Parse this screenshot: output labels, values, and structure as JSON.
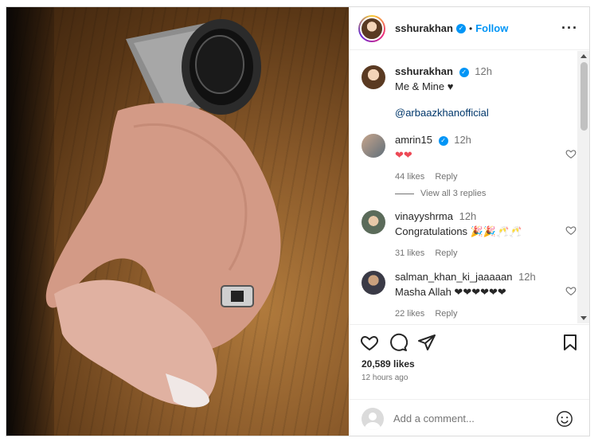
{
  "header": {
    "username": "sshurakhan",
    "follow_label": "Follow",
    "more_icon": "more-horizontal-icon"
  },
  "caption": {
    "username": "sshurakhan",
    "time": "12h",
    "text": "Me & Mine ♥",
    "tag": "@arbaazkhanofficial"
  },
  "comments": [
    {
      "username": "amrin15",
      "verified": true,
      "time": "12h",
      "text": "❤❤",
      "likes": "44 likes",
      "reply_label": "Reply"
    },
    {
      "username": "vinayyshrma",
      "verified": false,
      "time": "12h",
      "text": "Congratulations 🎉🎉🥂🥂",
      "likes": "31 likes",
      "reply_label": "Reply"
    },
    {
      "username": "salman_khan_ki_jaaaaan",
      "verified": false,
      "time": "12h",
      "text": "Masha Allah ❤❤❤❤❤❤",
      "likes": "22 likes",
      "reply_label": "Reply"
    }
  ],
  "view_replies_label": "View all 3 replies",
  "actions": {
    "like_count": "20,589 likes",
    "time_ago": "12 hours ago"
  },
  "add_comment": {
    "placeholder": "Add a comment..."
  },
  "colors": {
    "accent": "#0095f6",
    "heart_red": "#ed4956",
    "muted": "#737373"
  }
}
